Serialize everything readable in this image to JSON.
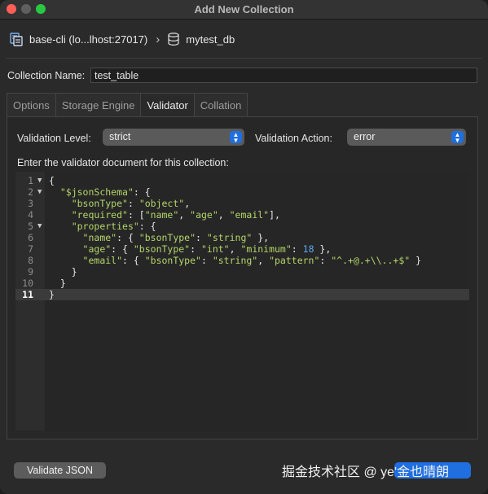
{
  "window": {
    "title": "Add New Collection"
  },
  "breadcrumb": {
    "server": "base-cli (lo...lhost:27017)",
    "separator": "›",
    "database": "mytest_db"
  },
  "collection": {
    "label": "Collection Name:",
    "value": "test_table"
  },
  "tabs": [
    {
      "label": "Options",
      "active": false
    },
    {
      "label": "Storage Engine",
      "active": false
    },
    {
      "label": "Validator",
      "active": true
    },
    {
      "label": "Collation",
      "active": false
    }
  ],
  "validator": {
    "level_label": "Validation Level:",
    "level_value": "strict",
    "action_label": "Validation Action:",
    "action_value": "error",
    "editor_prompt": "Enter the validator document for this collection:"
  },
  "editor": {
    "lines": [
      {
        "num": "1",
        "fold": "▼",
        "text": "{"
      },
      {
        "num": "2",
        "fold": "▼",
        "text": "  \"$jsonSchema\": {"
      },
      {
        "num": "3",
        "fold": "",
        "text": "    \"bsonType\": \"object\","
      },
      {
        "num": "4",
        "fold": "",
        "text": "    \"required\": [\"name\", \"age\", \"email\"],"
      },
      {
        "num": "5",
        "fold": "▼",
        "text": "    \"properties\": {"
      },
      {
        "num": "6",
        "fold": "",
        "text": "      \"name\": { \"bsonType\": \"string\" },"
      },
      {
        "num": "7",
        "fold": "",
        "text": "      \"age\": { \"bsonType\": \"int\", \"minimum\": 18 },"
      },
      {
        "num": "8",
        "fold": "",
        "text": "      \"email\": { \"bsonType\": \"string\", \"pattern\": \"^.+@.+\\\\..+$\" }"
      },
      {
        "num": "9",
        "fold": "",
        "text": "    }"
      },
      {
        "num": "10",
        "fold": "",
        "text": "  }"
      },
      {
        "num": "11",
        "fold": "",
        "text": "}"
      }
    ],
    "current_line": 11
  },
  "footer": {
    "validate_label": "Validate JSON",
    "watermark": "掘金技术社区 @ ye'金也晴朗"
  },
  "colors": {
    "accent": "#1f6fe0",
    "string": "#b4d56a",
    "number": "#5aa8f0"
  },
  "icons": {
    "server": "server-icon",
    "separator": "chevron-right-icon",
    "database": "database-icon",
    "select": "updown-chevron-icon"
  }
}
